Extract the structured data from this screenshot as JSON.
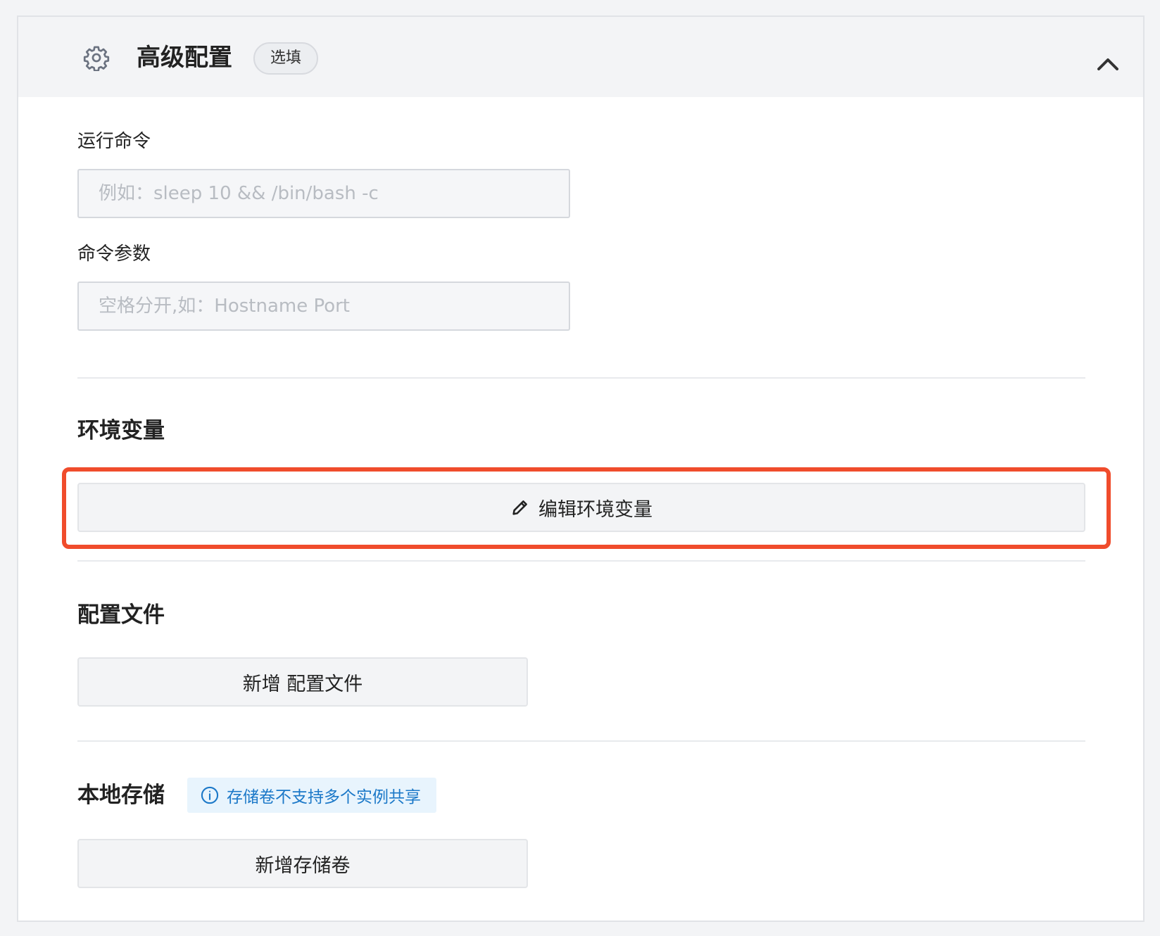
{
  "header": {
    "icon": "gear-icon",
    "title": "高级配置",
    "badge": "选填",
    "toggle_icon": "chevron-up-icon"
  },
  "fields": {
    "run_command": {
      "label": "运行命令",
      "value": "",
      "placeholder": "例如：sleep 10 && /bin/bash -c"
    },
    "command_args": {
      "label": "命令参数",
      "value": "",
      "placeholder": "空格分开,如：Hostname Port"
    }
  },
  "env": {
    "title": "环境变量",
    "edit_button": "编辑环境变量",
    "edit_icon": "pencil-icon",
    "highlight_color": "#f04c2c"
  },
  "config_files": {
    "title": "配置文件",
    "add_button": "新增 配置文件"
  },
  "storage": {
    "title": "本地存储",
    "tip": "存储卷不支持多个实例共享",
    "tip_icon": "info-icon",
    "tip_color": "#1b78c8",
    "add_button": "新增存储卷"
  }
}
